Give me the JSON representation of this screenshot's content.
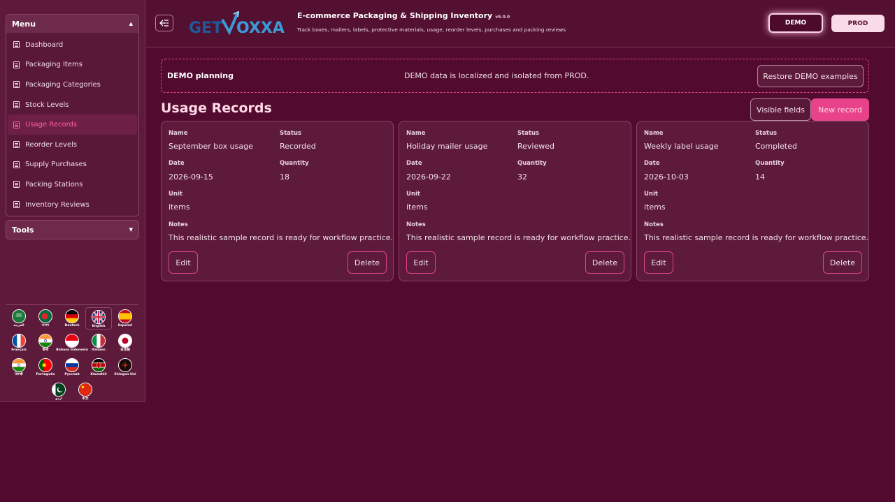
{
  "app": {
    "title": "E-commerce Packaging & Shipping Inventory",
    "version": "v9.0.0",
    "subtitle": "Track boxes, mailers, labels, protective materials, usage, reorder levels, purchases and packing reviews",
    "logo_text": "GETVOXXA",
    "env_demo": "DEMO",
    "env_prod": "PROD"
  },
  "sidebar": {
    "menu_title": "Menu",
    "tools_title": "Tools",
    "items": [
      {
        "label": "Dashboard"
      },
      {
        "label": "Packaging Items"
      },
      {
        "label": "Packaging Categories"
      },
      {
        "label": "Stock Levels"
      },
      {
        "label": "Usage Records",
        "active": true
      },
      {
        "label": "Reorder Levels"
      },
      {
        "label": "Supply Purchases"
      },
      {
        "label": "Packing Stations"
      },
      {
        "label": "Inventory Reviews"
      }
    ],
    "languages": [
      {
        "label": "العربية",
        "flag": "sa"
      },
      {
        "label": "বাংলা",
        "flag": "bd"
      },
      {
        "label": "Deutsch",
        "flag": "de"
      },
      {
        "label": "English",
        "flag": "gb",
        "active": true
      },
      {
        "label": "Español",
        "flag": "es"
      },
      {
        "label": "Français",
        "flag": "fr"
      },
      {
        "label": "हिन्दी",
        "flag": "in"
      },
      {
        "label": "Bahasa Indonesia",
        "flag": "id"
      },
      {
        "label": "Italiano",
        "flag": "it"
      },
      {
        "label": "日本語",
        "flag": "jp"
      },
      {
        "label": "ਪੰਜਾਬੀ",
        "flag": "in"
      },
      {
        "label": "Português",
        "flag": "pt"
      },
      {
        "label": "Русский",
        "flag": "ru"
      },
      {
        "label": "Kiswahili",
        "flag": "ke"
      },
      {
        "label": "Shingan Hoi",
        "flag": "sh"
      },
      {
        "label": "اردو",
        "flag": "pk"
      },
      {
        "label": "中文",
        "flag": "cn"
      }
    ]
  },
  "banner": {
    "title": "DEMO planning",
    "message": "DEMO data is localized and isolated from PROD.",
    "restore_label": "Restore DEMO examples"
  },
  "page": {
    "title": "Usage Records",
    "visible_fields_label": "Visible fields",
    "new_record_label": "New record"
  },
  "labels": {
    "name": "Name",
    "status": "Status",
    "date": "Date",
    "quantity": "Quantity",
    "unit": "Unit",
    "notes": "Notes",
    "edit": "Edit",
    "delete": "Delete"
  },
  "records": [
    {
      "name": "September box usage",
      "status": "Recorded",
      "date": "2026-09-15",
      "quantity": "18",
      "unit": "items",
      "notes": "This realistic sample record is ready for workflow practice."
    },
    {
      "name": "Holiday mailer usage",
      "status": "Reviewed",
      "date": "2026-09-22",
      "quantity": "32",
      "unit": "items",
      "notes": "This realistic sample record is ready for workflow practice."
    },
    {
      "name": "Weekly label usage",
      "status": "Completed",
      "date": "2026-10-03",
      "quantity": "14",
      "unit": "items",
      "notes": "This realistic sample record is ready for workflow practice."
    }
  ]
}
